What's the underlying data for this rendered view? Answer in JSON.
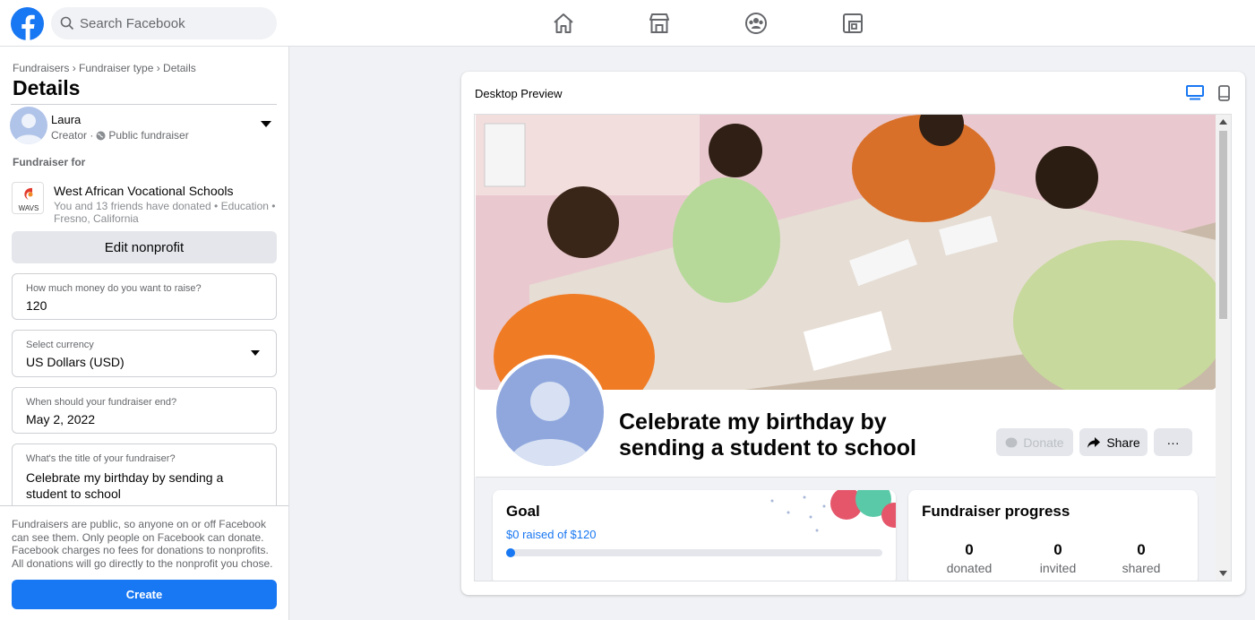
{
  "topbar": {
    "search_placeholder": "Search Facebook",
    "nav_icons": [
      "home-icon",
      "marketplace-icon",
      "groups-icon",
      "gaming-icon"
    ]
  },
  "left": {
    "breadcrumb": "Fundraisers › Fundraiser type › Details",
    "title": "Details",
    "creator": {
      "name": "Laura",
      "role": "Creator ·",
      "visibility": "Public fundraiser"
    },
    "fundraiser_for_label": "Fundraiser for",
    "nonprofit": {
      "logo_text": "WAVS",
      "name": "West African Vocational Schools",
      "meta": "You and 13 friends have donated • Education • Fresno, California"
    },
    "edit_nonprofit": "Edit nonprofit",
    "fields": {
      "amount_label": "How much money do you want to raise?",
      "amount_value": "120",
      "currency_label": "Select currency",
      "currency_value": "US Dollars (USD)",
      "end_label": "When should your fundraiser end?",
      "end_value": "May 2, 2022",
      "title_label": "What's the title of your fundraiser?",
      "title_value": "Celebrate my birthday by sending a student to school"
    },
    "notice": "Fundraisers are public, so anyone on or off Facebook can see them. Only people on Facebook can donate. Facebook charges no fees for donations to nonprofits. All donations will go directly to the nonprofit you chose.",
    "create": "Create"
  },
  "preview": {
    "title": "Desktop Preview",
    "fundraiser_title": "Celebrate my birthday by sending a student to school",
    "donate": "Donate",
    "share": "Share",
    "more": "···",
    "goal": {
      "title": "Goal",
      "raised": "$0 raised of $120",
      "progress": 0
    },
    "progress": {
      "title": "Fundraiser progress",
      "donated_num": "0",
      "donated_lbl": "donated",
      "invited_num": "0",
      "invited_lbl": "invited",
      "shared_num": "0",
      "shared_lbl": "shared"
    }
  },
  "colors": {
    "brand": "#1877f2",
    "background": "#f0f2f5"
  }
}
